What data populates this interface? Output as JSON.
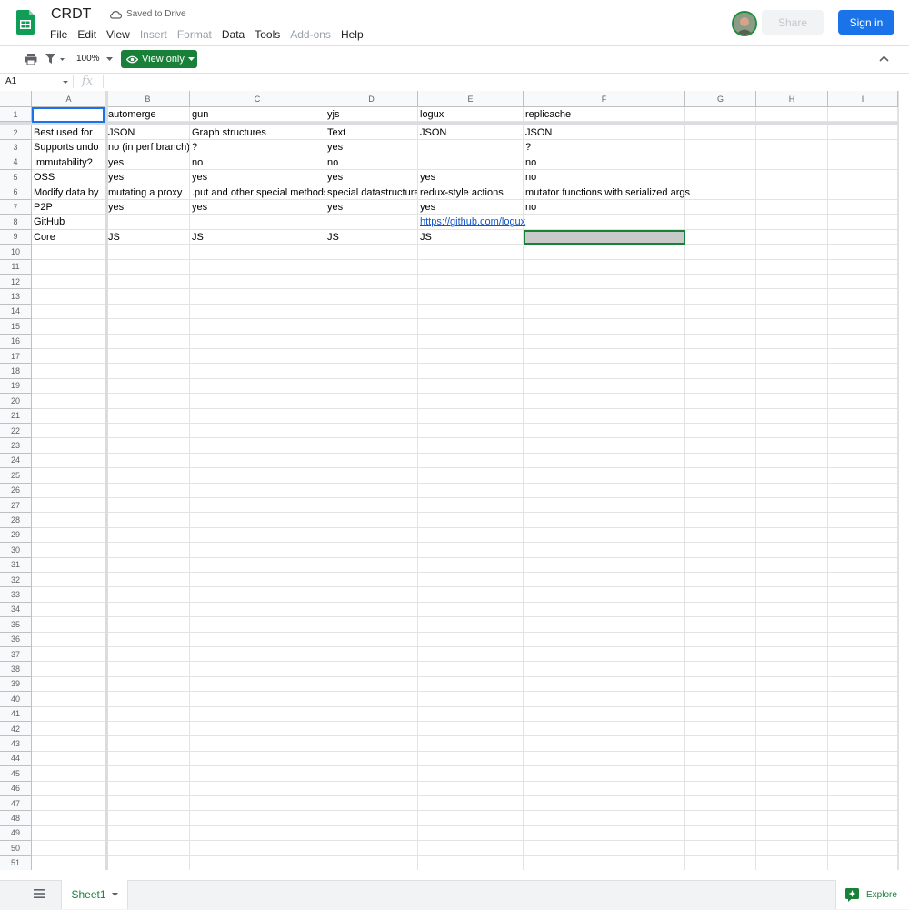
{
  "document": {
    "title": "CRDT",
    "save_status": "Saved to Drive"
  },
  "menu": [
    "File",
    "Edit",
    "View",
    "Insert",
    "Format",
    "Data",
    "Tools",
    "Add-ons",
    "Help"
  ],
  "menu_disabled": [
    "Insert",
    "Format",
    "Add-ons"
  ],
  "header": {
    "share_label": "Share",
    "signin_label": "Sign in"
  },
  "toolbar": {
    "zoom": "100%",
    "view_only_label": "View only"
  },
  "formula_bar": {
    "cell_ref": "A1",
    "fx": "fx",
    "value": ""
  },
  "columns": [
    "A",
    "B",
    "C",
    "D",
    "E",
    "F",
    "G",
    "H",
    "I"
  ],
  "row_count": 51,
  "cells": {
    "r1": [
      "",
      "automerge",
      "gun",
      "yjs",
      "logux",
      "replicache"
    ],
    "r2": [
      "Best used for",
      "JSON",
      "Graph structures",
      "Text",
      "JSON",
      "JSON"
    ],
    "r3": [
      "Supports undo",
      "no (in perf branch)",
      "?",
      "yes",
      "",
      "?"
    ],
    "r4": [
      "Immutability?",
      "yes",
      "no",
      "no",
      "",
      "no"
    ],
    "r5": [
      "OSS",
      "yes",
      "yes",
      "yes",
      "yes",
      "no"
    ],
    "r6": [
      "Modify data by",
      "mutating a proxy",
      ".put and other special methods",
      "special datastructures",
      "redux-style actions",
      "mutator functions with serialized args"
    ],
    "r7": [
      "P2P",
      "yes",
      "yes",
      "yes",
      "yes",
      "no"
    ],
    "r8": [
      "GitHub",
      "",
      "",
      "",
      "https://github.com/logux",
      ""
    ],
    "r9": [
      "Core",
      "JS",
      "JS",
      "JS",
      "JS",
      ""
    ]
  },
  "sheets": {
    "active": "Sheet1"
  },
  "explore_label": "Explore",
  "colors": {
    "brand_green": "#188038",
    "blue": "#1a73e8",
    "link": "#1155cc"
  }
}
